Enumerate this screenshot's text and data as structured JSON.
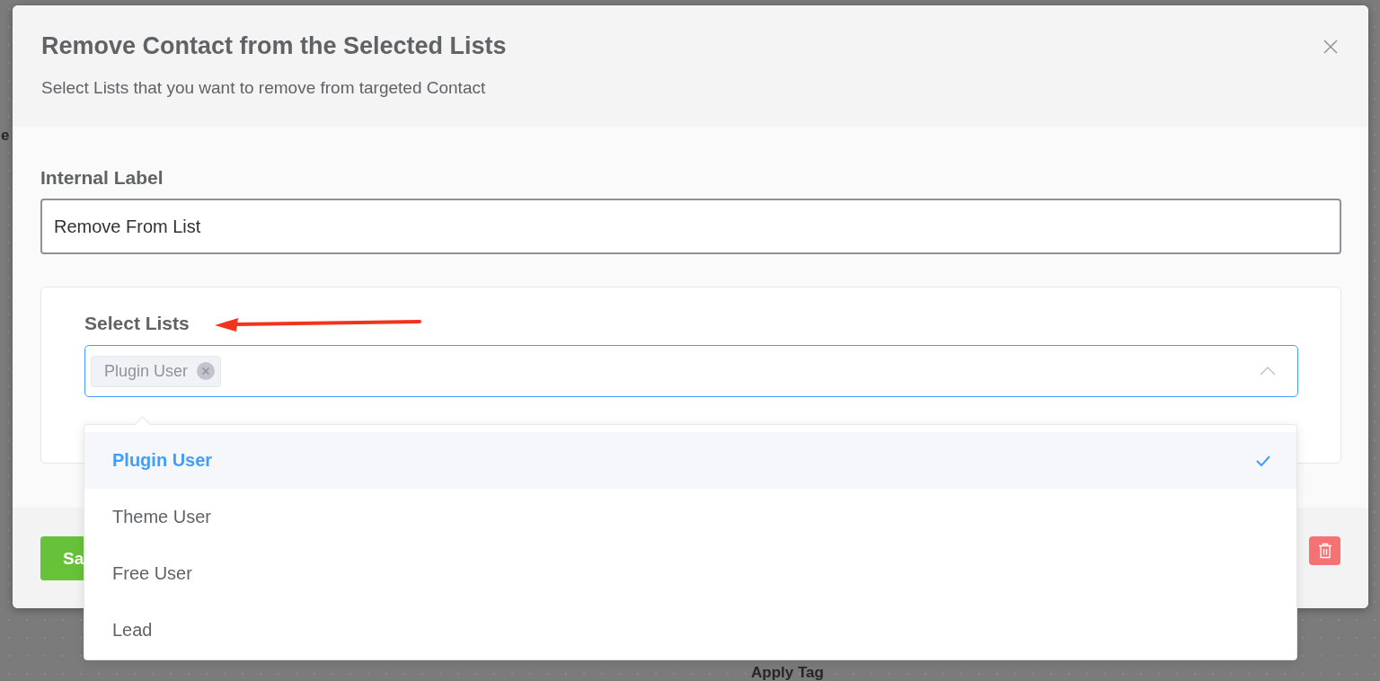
{
  "background": {
    "texts": [
      "e",
      "Apply Tag"
    ]
  },
  "modal": {
    "title": "Remove Contact from the Selected Lists",
    "subtitle": "Select Lists that you want to remove from targeted Contact"
  },
  "internal_label": {
    "label": "Internal Label",
    "value": "Remove From List"
  },
  "select_lists": {
    "label": "Select Lists",
    "expanded": true,
    "tags": [
      "Plugin User"
    ],
    "options": [
      {
        "label": "Plugin User",
        "selected": true
      },
      {
        "label": "Theme User",
        "selected": false
      },
      {
        "label": "Free User",
        "selected": false
      },
      {
        "label": "Lead",
        "selected": false
      }
    ]
  },
  "footer": {
    "save_button": "Sa"
  }
}
